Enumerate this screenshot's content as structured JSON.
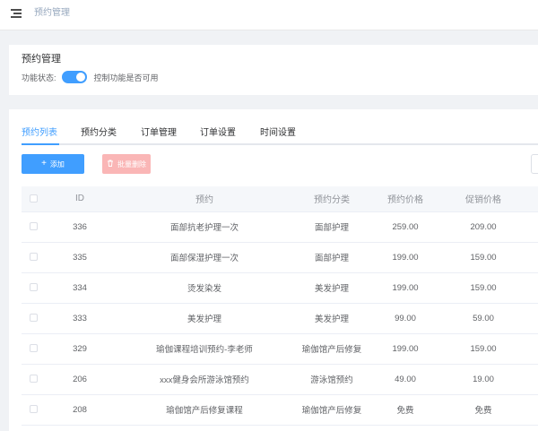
{
  "breadcrumb": "预约管理",
  "header": {
    "title": "预约管理",
    "status_label": "功能状态:",
    "status_enabled": true,
    "status_hint": "控制功能是否可用"
  },
  "tabs": [
    "预约列表",
    "预约分类",
    "订单管理",
    "订单设置",
    "时间设置"
  ],
  "active_tab": 0,
  "buttons": {
    "add": "添加",
    "batch_delete": "批量删除"
  },
  "table": {
    "columns": [
      "ID",
      "预约",
      "预约分类",
      "预约价格",
      "促销价格"
    ],
    "rows": [
      [
        "336",
        "面部抗老护理一次",
        "面部护理",
        "259.00",
        "209.00"
      ],
      [
        "335",
        "面部保湿护理一次",
        "面部护理",
        "199.00",
        "159.00"
      ],
      [
        "334",
        "烫发染发",
        "美发护理",
        "199.00",
        "159.00"
      ],
      [
        "333",
        "美发护理",
        "美发护理",
        "99.00",
        "59.00"
      ],
      [
        "329",
        "瑜伽课程培训预约-李老师",
        "瑜伽馆产后修复",
        "199.00",
        "159.00"
      ],
      [
        "206",
        "xxx健身会所游泳馆预约",
        "游泳馆预约",
        "49.00",
        "19.00"
      ],
      [
        "208",
        "瑜伽馆产后修复课程",
        "瑜伽馆产后修复",
        "免费",
        "免费"
      ]
    ]
  },
  "colors": {
    "primary": "#409eff",
    "danger_light": "#fab6b6"
  },
  "icons": {
    "menu": "hamburger-icon",
    "add": "plus-icon",
    "delete": "trash-icon"
  }
}
